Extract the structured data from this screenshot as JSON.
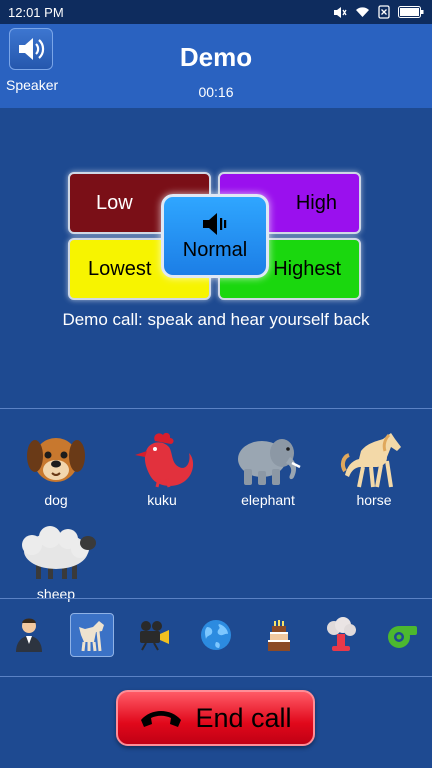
{
  "status_bar": {
    "time": "12:01 PM"
  },
  "header": {
    "speaker_label": "Speaker",
    "title": "Demo",
    "timer": "00:16"
  },
  "voice_pad": {
    "low": "Low",
    "high": "High",
    "lowest": "Lowest",
    "highest": "Highest",
    "normal": "Normal"
  },
  "demo_text": "Demo call: speak and hear yourself back",
  "sounds": [
    {
      "name": "dog",
      "icon": "dog-icon"
    },
    {
      "name": "kuku",
      "icon": "rooster-icon"
    },
    {
      "name": "elephant",
      "icon": "elephant-icon"
    },
    {
      "name": "horse",
      "icon": "horse-icon"
    },
    {
      "name": "sheep",
      "icon": "sheep-icon"
    }
  ],
  "toolbar": {
    "icons": [
      "person-icon",
      "animal-icon",
      "movie-camera-icon",
      "globe-icon",
      "birthday-cake-icon",
      "explosion-icon",
      "whistle-icon"
    ],
    "active_index": 1
  },
  "end_call": {
    "label": "End call"
  },
  "colors": {
    "background": "#1e4a91",
    "header": "#2a62c0",
    "low": "#7a0f17",
    "high": "#9a10ee",
    "lowest": "#f7f400",
    "highest": "#1ad70e",
    "normal": "#1c7ee6",
    "end_call": "#e1081b"
  }
}
